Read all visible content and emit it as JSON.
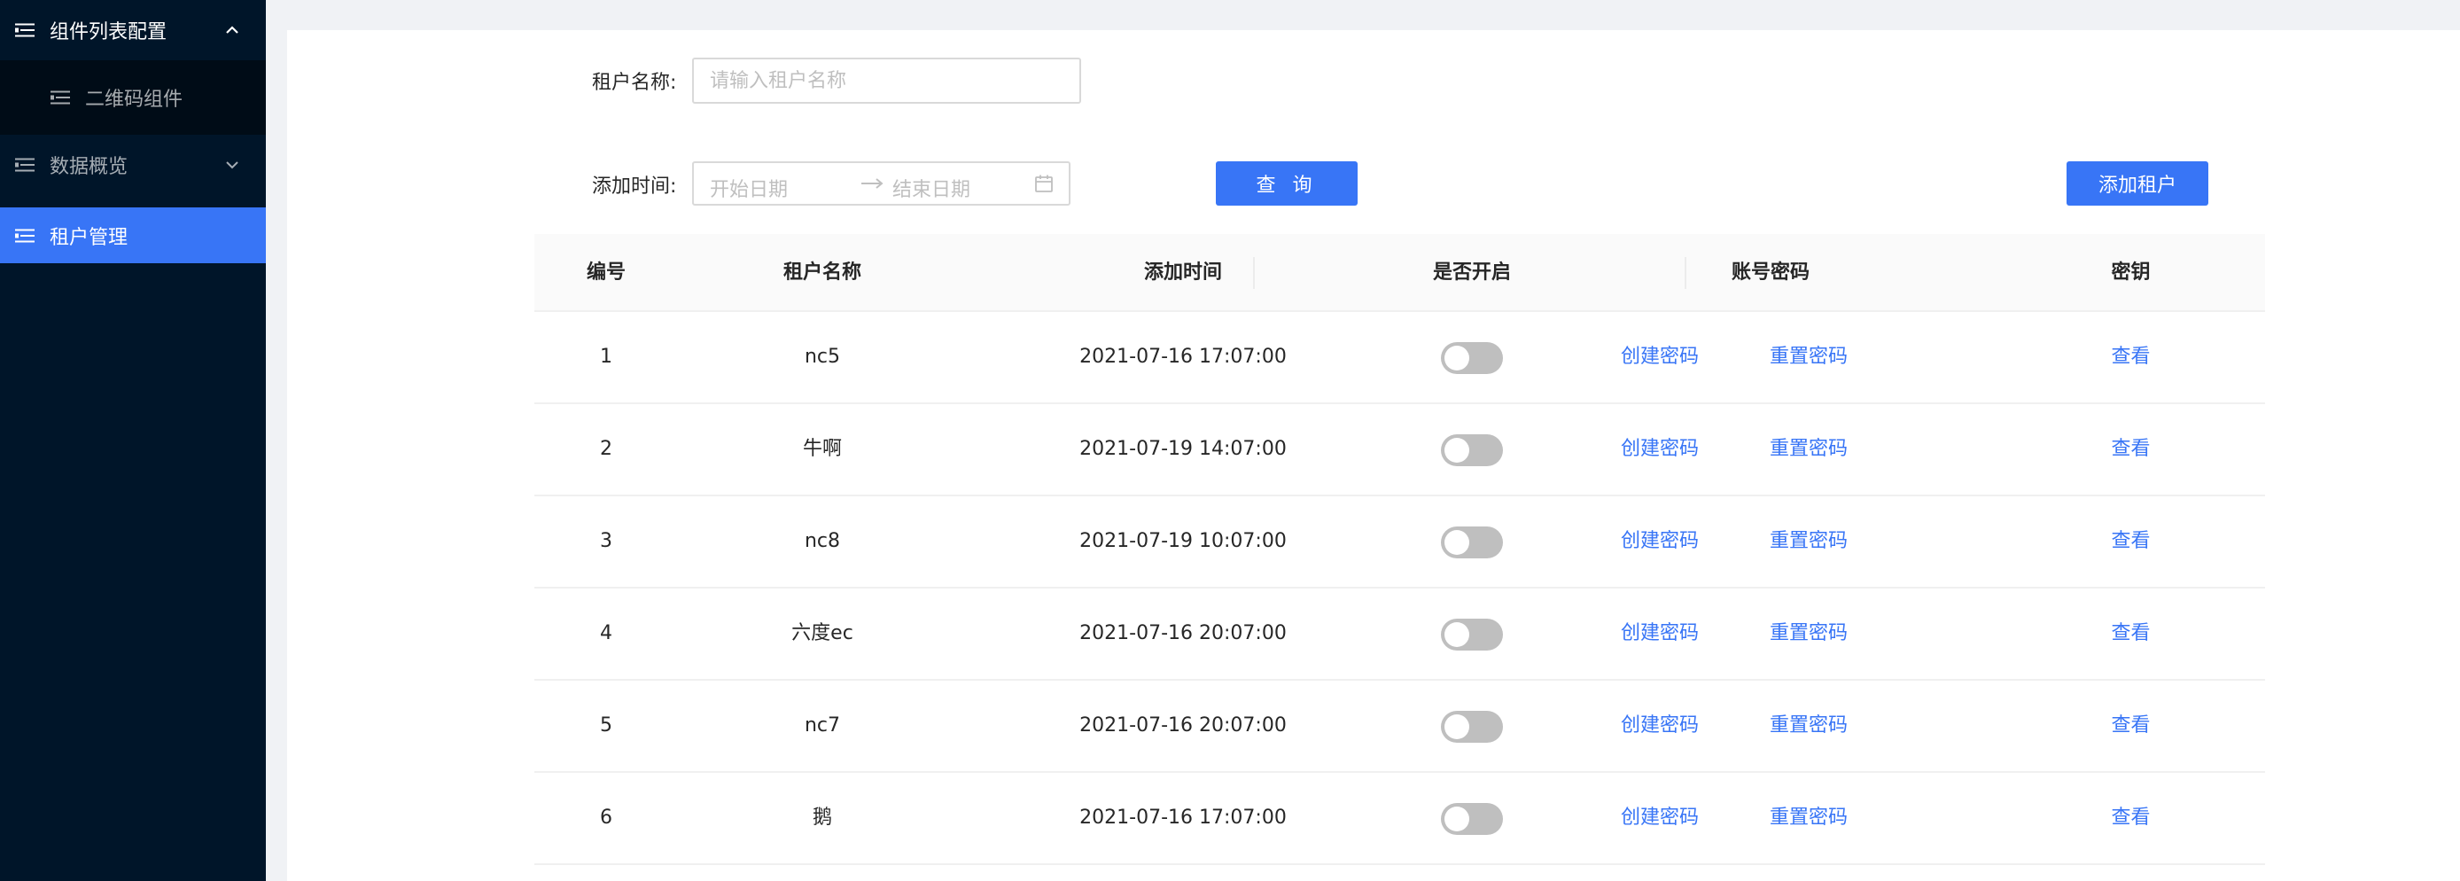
{
  "sidebar": {
    "items": [
      {
        "label": "组件列表配置",
        "icon": "menu-list-icon",
        "chevron": "chevron-up-icon"
      },
      {
        "label": "二维码组件",
        "icon": "menu-list-icon"
      },
      {
        "label": "数据概览",
        "icon": "menu-list-icon",
        "chevron": "chevron-down-icon"
      },
      {
        "label": "租户管理",
        "icon": "menu-list-icon"
      }
    ],
    "active_color": "#3875f6",
    "background": "#001529"
  },
  "filters": {
    "name_label": "租户名称:",
    "name_placeholder": "请输入租户名称",
    "name_value": "",
    "time_label": "添加时间:",
    "start_placeholder": "开始日期",
    "end_placeholder": "结束日期"
  },
  "buttons": {
    "query": "查 询",
    "add": "添加租户"
  },
  "table": {
    "headers": {
      "id": "编号",
      "name": "租户名称",
      "time": "添加时间",
      "enabled": "是否开启",
      "account": "账号密码",
      "key": "密钥"
    },
    "rows": [
      {
        "id": "1",
        "name": "nc5",
        "time": "2021-07-16 17:07:00",
        "enabled": false,
        "create": "创建密码",
        "reset": "重置密码",
        "view": "查看"
      },
      {
        "id": "2",
        "name": "牛啊",
        "time": "2021-07-19 14:07:00",
        "enabled": false,
        "create": "创建密码",
        "reset": "重置密码",
        "view": "查看"
      },
      {
        "id": "3",
        "name": "nc8",
        "time": "2021-07-19 10:07:00",
        "enabled": false,
        "create": "创建密码",
        "reset": "重置密码",
        "view": "查看"
      },
      {
        "id": "4",
        "name": "六度ec",
        "time": "2021-07-16 20:07:00",
        "enabled": false,
        "create": "创建密码",
        "reset": "重置密码",
        "view": "查看"
      },
      {
        "id": "5",
        "name": "nc7",
        "time": "2021-07-16 20:07:00",
        "enabled": false,
        "create": "创建密码",
        "reset": "重置密码",
        "view": "查看"
      },
      {
        "id": "6",
        "name": "鹅",
        "time": "2021-07-16 17:07:00",
        "enabled": false,
        "create": "创建密码",
        "reset": "重置密码",
        "view": "查看"
      }
    ]
  },
  "colors": {
    "primary": "#3875f6",
    "switch_off": "#bfbfbf"
  }
}
